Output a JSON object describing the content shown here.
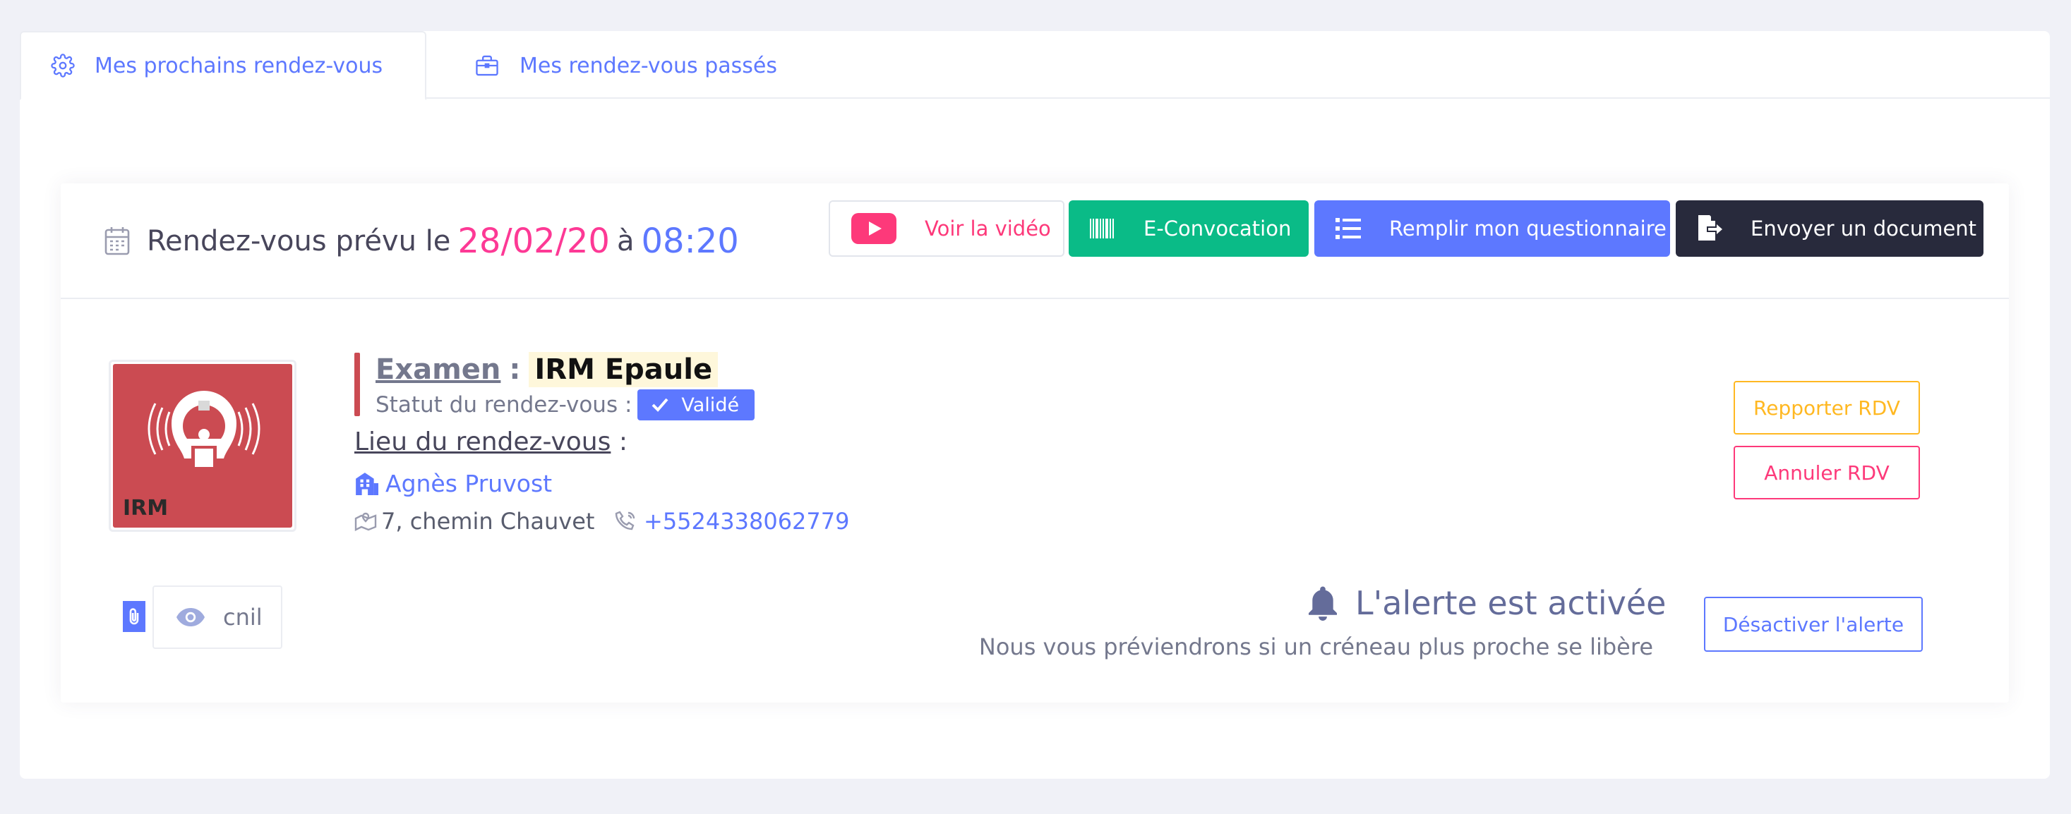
{
  "tabs": [
    {
      "label": "Mes prochains rendez-vous",
      "icon": "gear-icon",
      "active": true
    },
    {
      "label": "Mes rendez-vous passés",
      "icon": "briefcase-icon",
      "active": false
    }
  ],
  "appointment": {
    "title_prefix": "Rendez-vous prévu le",
    "date": "28/02/20",
    "at": "à",
    "time": "08:20",
    "actions": {
      "video": "Voir la vidéo",
      "convocation": "E-Convocation",
      "questionnaire": "Remplir mon questionnaire",
      "document": "Envoyer un document"
    },
    "exam_label": "Examen",
    "exam_value": "IRM Epaule",
    "exam_icon_label": "IRM",
    "status_label": "Statut du rendez-vous :",
    "status_value": "Validé",
    "location_label": "Lieu du rendez-vous",
    "location_name": "Agnès Pruvost",
    "address": "7, chemin Chauvet",
    "phone": "+5524338062779",
    "report_button": "Repporter RDV",
    "cancel_button": "Annuler RDV",
    "attachment_label": "cnil",
    "alert_title": "L'alerte est activée",
    "alert_subtitle": "Nous vous préviendrons si un créneau plus proche se libère",
    "disable_alert_button": "Désactiver l'alerte"
  },
  "colors": {
    "accent": "#5d78ff",
    "danger": "#fd397a",
    "success": "#0abb87",
    "dark": "#282a3c",
    "warning": "#ffb822",
    "irm_red": "#cb4b52"
  }
}
